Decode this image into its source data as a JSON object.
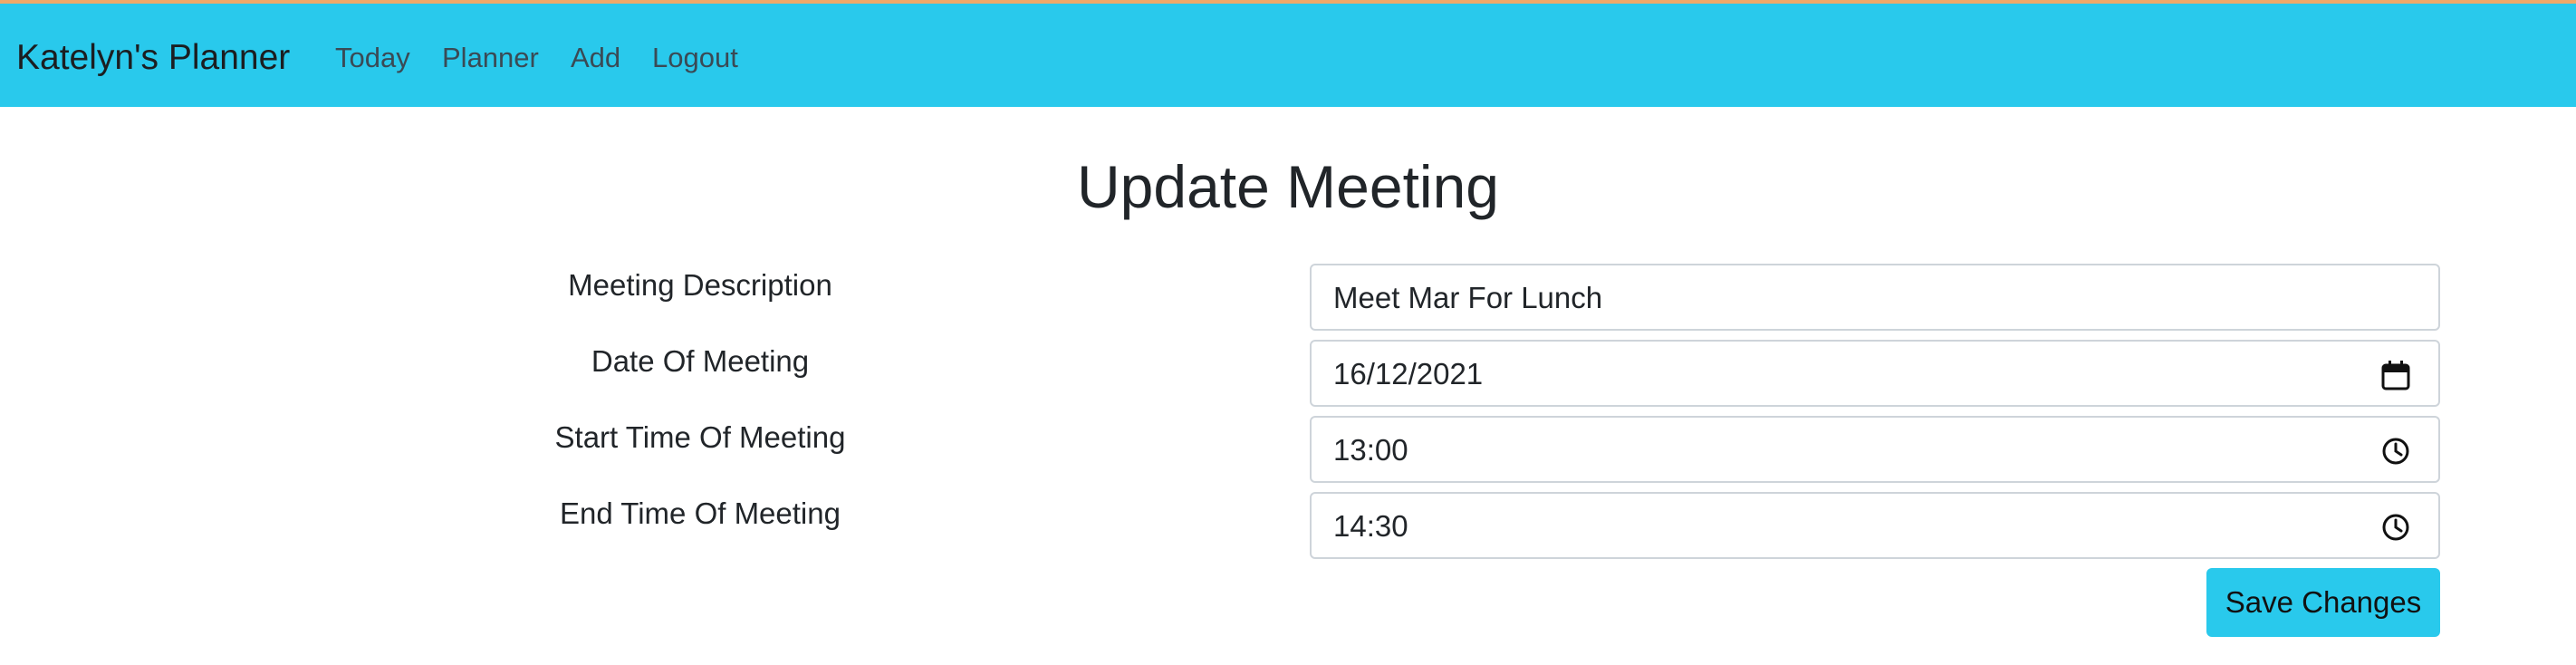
{
  "nav": {
    "brand": "Katelyn's Planner",
    "links": [
      {
        "label": "Today"
      },
      {
        "label": "Planner"
      },
      {
        "label": "Add"
      },
      {
        "label": "Logout"
      }
    ]
  },
  "page": {
    "title": "Update Meeting"
  },
  "form": {
    "description": {
      "label": "Meeting Description",
      "value": "Meet Mar For Lunch"
    },
    "date": {
      "label": "Date Of Meeting",
      "value": "16/12/2021",
      "icon": "calendar-icon"
    },
    "start_time": {
      "label": "Start Time Of Meeting",
      "value": "13:00",
      "icon": "clock-icon"
    },
    "end_time": {
      "label": "End Time Of Meeting",
      "value": "14:30",
      "icon": "clock-icon"
    },
    "save_label": "Save Changes"
  },
  "colors": {
    "navbar": "#29c9ec",
    "button": "#29c9ec",
    "accent_strip": "#f0a868"
  }
}
